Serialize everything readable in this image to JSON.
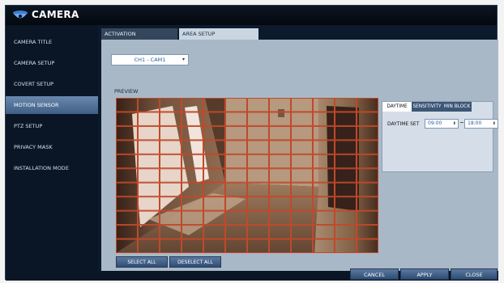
{
  "window": {
    "title": "CAMERA",
    "title_icon": "camera-icon"
  },
  "sidebar": {
    "items": [
      {
        "label": "CAMERA TITLE",
        "active": false
      },
      {
        "label": "CAMERA SETUP",
        "active": false
      },
      {
        "label": "COVERT SETUP",
        "active": false
      },
      {
        "label": "MOTION SENSOR",
        "active": true
      },
      {
        "label": "PTZ SETUP",
        "active": false
      },
      {
        "label": "PRIVACY MASK",
        "active": false
      },
      {
        "label": "INSTALLATION MODE",
        "active": false
      }
    ]
  },
  "tabs": [
    {
      "label": "ACTIVATION",
      "active": false
    },
    {
      "label": "AREA SETUP",
      "active": true
    }
  ],
  "channel_select": {
    "value": "CH1 - CAM1"
  },
  "preview": {
    "label": "PREVIEW",
    "grid": {
      "columns": 12,
      "rows": 11,
      "all_selected": true,
      "line_color": "#c0492b"
    }
  },
  "buttons": {
    "select_all": "SELECT ALL",
    "deselect_all": "DESELECT ALL"
  },
  "settings_panel": {
    "tabs": [
      {
        "label": "DAYTIME",
        "active": true
      },
      {
        "label": "SENSITIVITY",
        "active": false
      },
      {
        "label": "MIN BLOCK",
        "active": false
      }
    ],
    "daytime_set_label": "DAYTIME SET",
    "start_time": "09:00",
    "separator": "~",
    "end_time": "18:00"
  },
  "footer": {
    "cancel": "CANCEL",
    "apply": "APPLY",
    "close": "CLOSE"
  },
  "colors": {
    "accent": "#4a6b95",
    "active_sidebar": "#5a7aa2",
    "window_bg": "#0c1a2c",
    "content_bg": "#a9b8c6"
  }
}
